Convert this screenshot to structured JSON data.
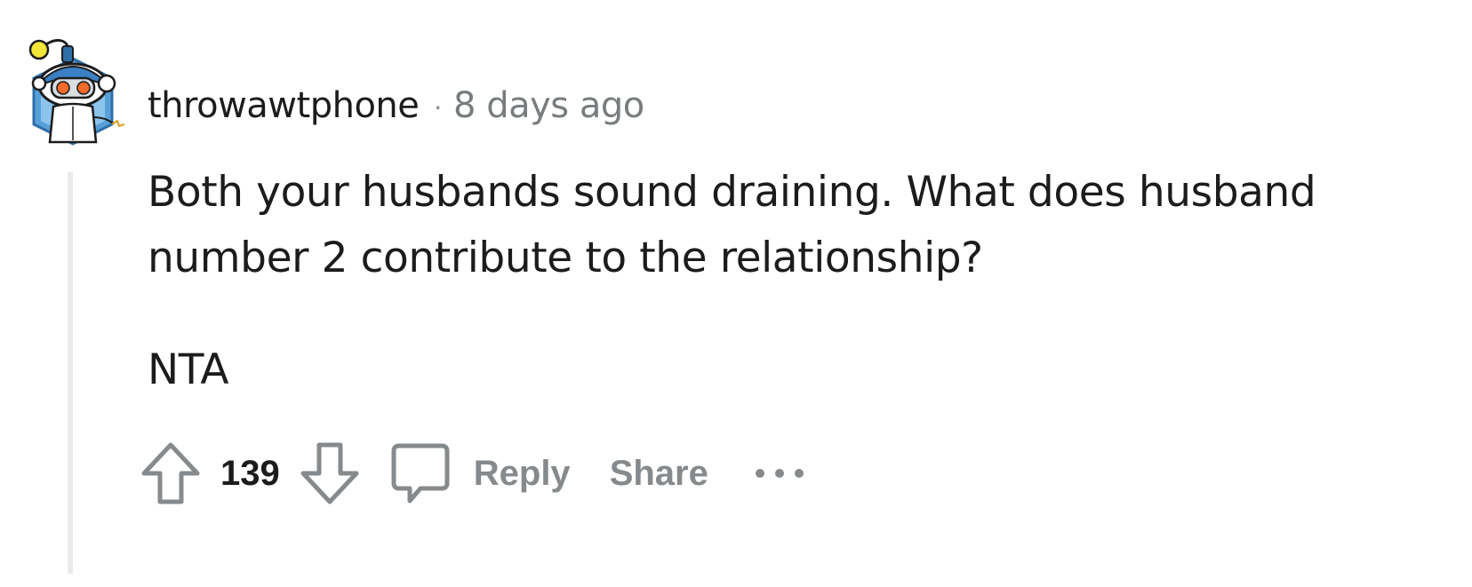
{
  "comment": {
    "author": "throwawtphone",
    "separator": "·",
    "timestamp": "8 days ago",
    "body": [
      "Both your husbands sound draining. What does husband number 2 contribute to the relationship?",
      "NTA"
    ],
    "vote_count": "139",
    "actions": {
      "reply_label": "Reply",
      "share_label": "Share"
    },
    "icons": {
      "avatar": "snoo-avatar",
      "upvote": "upvote-arrow-icon",
      "downvote": "downvote-arrow-icon",
      "reply": "comment-bubble-icon",
      "more": "more-options-icon"
    },
    "colors": {
      "text": "#1c1c1c",
      "meta": "#787c7e",
      "action": "#878a8c",
      "thread_line": "#e8eaec"
    }
  }
}
